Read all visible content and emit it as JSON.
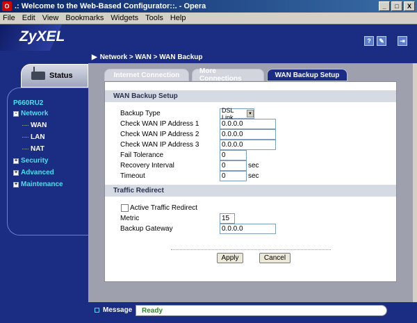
{
  "window": {
    "app_icon": "opera-icon",
    "title": "Welcome to the Web-Based Configurator::. - Opera",
    "title_prefix": ".:",
    "buttons": [
      "_",
      "□",
      "X"
    ]
  },
  "menu": [
    "File",
    "Edit",
    "View",
    "Bookmarks",
    "Widgets",
    "Tools",
    "Help"
  ],
  "header": {
    "logo": "ZyXEL",
    "icons": [
      "help-icon",
      "wizard-icon",
      "logout-icon"
    ],
    "icon_glyphs": [
      "?",
      "✎",
      "⇥"
    ]
  },
  "breadcrumb": "Network > WAN > WAN Backup",
  "status_tab": "Status",
  "nav": {
    "device": "P660RU2",
    "network": "Network",
    "network_children": [
      "WAN",
      "LAN",
      "NAT"
    ],
    "security": "Security",
    "advanced": "Advanced",
    "maintenance": "Maintenance",
    "expand_glyph": "-",
    "collapse_glyph": "+"
  },
  "tabs": [
    "Internet Connection",
    "More Connections",
    "WAN Backup Setup"
  ],
  "active_tab": "WAN Backup Setup",
  "wan_backup": {
    "section_title": "WAN Backup Setup",
    "backup_type_label": "Backup Type",
    "backup_type_value": "DSL Link",
    "check_ip_1_label": "Check WAN IP Address  1",
    "check_ip_1_value": "0.0.0.0",
    "check_ip_2_label": "Check WAN IP Address  2",
    "check_ip_2_value": "0.0.0.0",
    "check_ip_3_label": "Check WAN IP Address  3",
    "check_ip_3_value": "0.0.0.0",
    "fail_tolerance_label": "Fail Tolerance",
    "fail_tolerance_value": "0",
    "recovery_interval_label": "Recovery Interval",
    "recovery_interval_value": "0",
    "timeout_label": "Timeout",
    "timeout_value": "0",
    "unit_sec": "sec"
  },
  "traffic_redirect": {
    "section_title": "Traffic Redirect",
    "active_label": "Active Traffic Redirect",
    "active_checked": false,
    "metric_label": "Metric",
    "metric_value": "15",
    "gateway_label": "Backup Gateway",
    "gateway_value": "0.0.0.0"
  },
  "buttons": {
    "apply": "Apply",
    "cancel": "Cancel"
  },
  "message": {
    "label": "Message",
    "value": "Ready"
  },
  "colors": {
    "brand_blue": "#1b2c83",
    "nav_cyan": "#48e0e8",
    "ready_green": "#2a8a2a"
  }
}
